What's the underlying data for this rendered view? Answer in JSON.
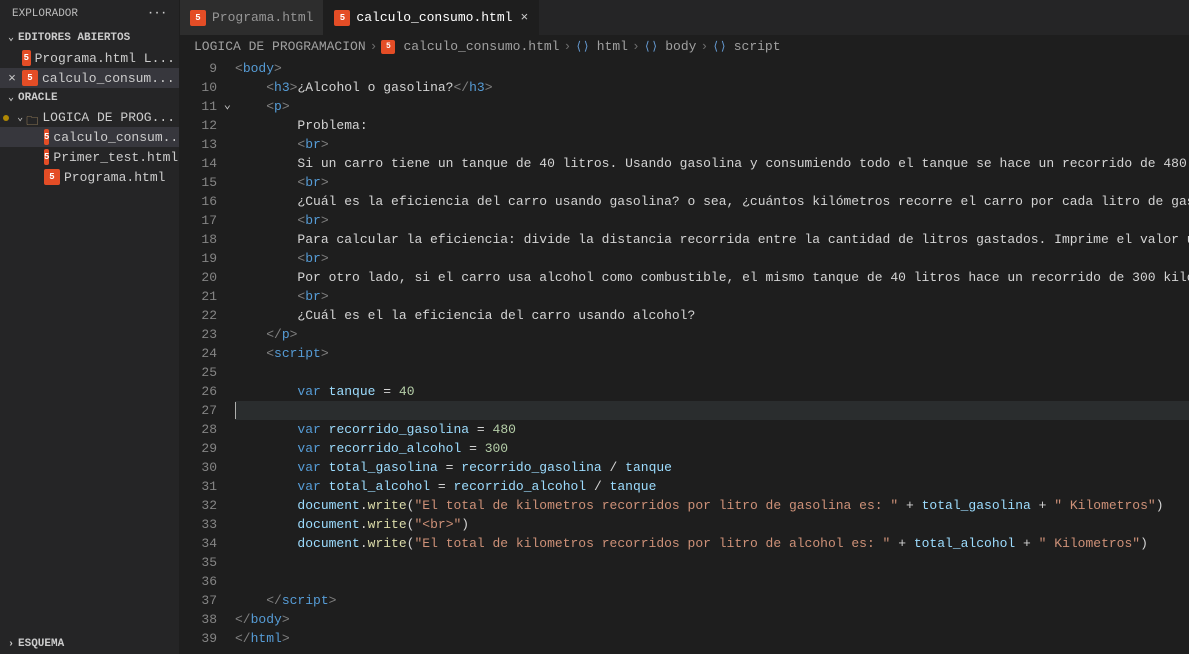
{
  "sidebar": {
    "title": "EXPLORADOR",
    "openEditors": {
      "label": "EDITORES ABIERTOS",
      "items": [
        {
          "name": "Programa.html  L...",
          "active": false,
          "close": ""
        },
        {
          "name": "calculo_consum...",
          "active": true,
          "close": "×"
        }
      ]
    },
    "workspace": {
      "label": "ORACLE",
      "folder": "LOGICA DE PROG...",
      "files": [
        {
          "name": "calculo_consum...",
          "active": true
        },
        {
          "name": "Primer_test.html",
          "active": false
        },
        {
          "name": "Programa.html",
          "active": false
        }
      ]
    },
    "outline": "ESQUEMA"
  },
  "tabs": [
    {
      "name": "Programa.html",
      "active": false
    },
    {
      "name": "calculo_consumo.html",
      "active": true
    }
  ],
  "breadcrumbs": {
    "root": "LOGICA DE PROGRAMACION",
    "file": "calculo_consumo.html",
    "path": [
      "html",
      "body",
      "script"
    ]
  },
  "editor": {
    "firstLine": 9,
    "lastLine": 39,
    "code": {
      "l9": {
        "indent": 0,
        "type": "tag-open",
        "tag": "body"
      },
      "l10": {
        "indent": 1,
        "type": "h3",
        "open": "h3",
        "text": "¿Alcohol o gasolina?",
        "close": "h3"
      },
      "l11": {
        "indent": 1,
        "type": "tag-open",
        "tag": "p"
      },
      "l12": {
        "indent": 2,
        "type": "text",
        "text": "Problema:"
      },
      "l13": {
        "indent": 2,
        "type": "br"
      },
      "l14": {
        "indent": 2,
        "type": "text",
        "text": "Si un carro tiene un tanque de 40 litros. Usando gasolina y consumiendo todo el tanque se hace un recorrido de 480 "
      },
      "l15": {
        "indent": 2,
        "type": "br"
      },
      "l16": {
        "indent": 2,
        "type": "text",
        "text": "¿Cuál es la eficiencia del carro usando gasolina? o sea, ¿cuántos kilómetros recorre el carro por cada litro de gas"
      },
      "l17": {
        "indent": 2,
        "type": "br"
      },
      "l18": {
        "indent": 2,
        "type": "text",
        "text": "Para calcular la eficiencia: divide la distancia recorrida entre la cantidad de litros gastados. Imprime el valor u"
      },
      "l19": {
        "indent": 2,
        "type": "br"
      },
      "l20": {
        "indent": 2,
        "type": "text",
        "text": "Por otro lado, si el carro usa alcohol como combustible, el mismo tanque de 40 litros hace un recorrido de 300 kiló"
      },
      "l21": {
        "indent": 2,
        "type": "br"
      },
      "l22": {
        "indent": 2,
        "type": "text",
        "text": "¿Cuál es el la eficiencia del carro usando alcohol?"
      },
      "l23": {
        "indent": 1,
        "type": "tag-close",
        "tag": "p"
      },
      "l24": {
        "indent": 1,
        "type": "tag-open",
        "tag": "script"
      },
      "l25": {
        "indent": 0,
        "type": "blank"
      },
      "l26": {
        "indent": 2,
        "type": "vardecl",
        "name": "tanque",
        "value": "40"
      },
      "l27": {
        "indent": 0,
        "type": "current"
      },
      "l28": {
        "indent": 2,
        "type": "vardecl",
        "name": "recorrido_gasolina",
        "value": "480"
      },
      "l29": {
        "indent": 2,
        "type": "vardecl",
        "name": "recorrido_alcohol",
        "value": "300"
      },
      "l30": {
        "indent": 2,
        "type": "varexpr",
        "name": "total_gasolina",
        "a": "recorrido_gasolina",
        "b": "tanque"
      },
      "l31": {
        "indent": 2,
        "type": "varexpr",
        "name": "total_alcohol",
        "a": "recorrido_alcohol",
        "b": "tanque"
      },
      "l32": {
        "indent": 2,
        "type": "docwrite",
        "str1": "\"El total de kilometros recorridos por litro de gasolina es: \"",
        "var": "total_gasolina",
        "str2": "\" Kilometros\""
      },
      "l33": {
        "indent": 2,
        "type": "docwritestr",
        "str": "\"<br>\""
      },
      "l34": {
        "indent": 2,
        "type": "docwrite",
        "str1": "\"El total de kilometros recorridos por litro de alcohol es: \"",
        "var": "total_alcohol",
        "str2": "\" Kilometros\""
      },
      "l35": {
        "indent": 0,
        "type": "blank"
      },
      "l36": {
        "indent": 0,
        "type": "blank"
      },
      "l37": {
        "indent": 1,
        "type": "tag-close",
        "tag": "script"
      },
      "l38": {
        "indent": 0,
        "type": "tag-close",
        "tag": "body"
      },
      "l39": {
        "indent": -1,
        "type": "tag-close",
        "tag": "html"
      }
    }
  }
}
